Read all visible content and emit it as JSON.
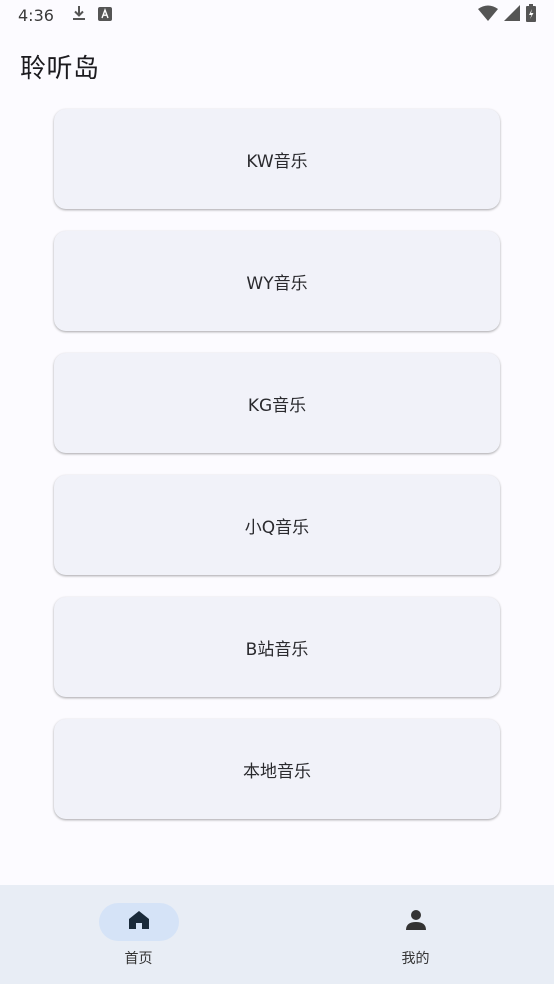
{
  "status_bar": {
    "time": "4:36",
    "left_icons": [
      "download-icon",
      "a-badge-icon"
    ],
    "right_icons": [
      "wifi-icon",
      "signal-icon",
      "battery-icon"
    ]
  },
  "header": {
    "title": "聆听岛"
  },
  "sources": [
    {
      "label": "KW音乐"
    },
    {
      "label": "WY音乐"
    },
    {
      "label": "KG音乐"
    },
    {
      "label": "小Q音乐"
    },
    {
      "label": "B站音乐"
    },
    {
      "label": "本地音乐"
    }
  ],
  "bottom_nav": {
    "items": [
      {
        "label": "首页",
        "icon": "home-icon",
        "active": true
      },
      {
        "label": "我的",
        "icon": "person-icon",
        "active": false
      }
    ]
  },
  "colors": {
    "background": "#fcfbff",
    "card": "#f1f2f9",
    "nav_bar": "#e8edf5",
    "nav_active_pill": "#d5e3f7",
    "icon_dark": "#1a2a3a"
  }
}
